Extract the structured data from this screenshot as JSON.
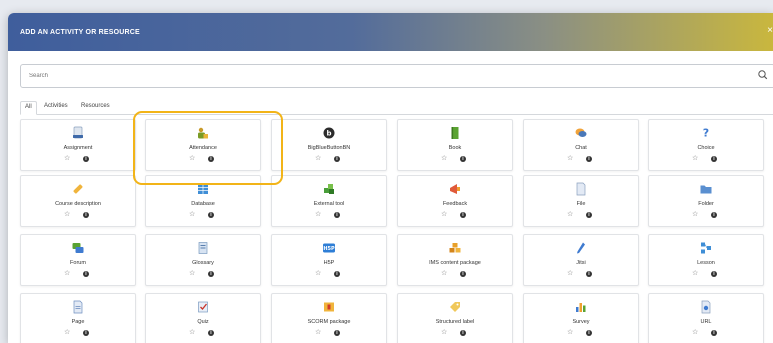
{
  "dialog": {
    "title": "ADD AN ACTIVITY OR RESOURCE",
    "close_label": "×"
  },
  "search": {
    "placeholder": "Search",
    "value": ""
  },
  "tabs": [
    {
      "label": "All"
    },
    {
      "label": "Activities"
    },
    {
      "label": "Resources"
    }
  ],
  "tile_controls": {
    "star": "☆",
    "info": "i"
  },
  "tiles": [
    {
      "label": "Assignment",
      "icon": "assignment-icon"
    },
    {
      "label": "Attendance",
      "icon": "attendance-icon"
    },
    {
      "label": "BigBlueButtonBN",
      "icon": "bigbluebutton-icon"
    },
    {
      "label": "Book",
      "icon": "book-icon"
    },
    {
      "label": "Chat",
      "icon": "chat-icon"
    },
    {
      "label": "Choice",
      "icon": "choice-icon"
    },
    {
      "label": "Course description",
      "icon": "course-description-icon"
    },
    {
      "label": "Database",
      "icon": "database-icon"
    },
    {
      "label": "External tool",
      "icon": "external-tool-icon"
    },
    {
      "label": "Feedback",
      "icon": "feedback-icon"
    },
    {
      "label": "File",
      "icon": "file-icon"
    },
    {
      "label": "Folder",
      "icon": "folder-icon"
    },
    {
      "label": "Forum",
      "icon": "forum-icon"
    },
    {
      "label": "Glossary",
      "icon": "glossary-icon"
    },
    {
      "label": "H5P",
      "icon": "h5p-icon"
    },
    {
      "label": "IMS content package",
      "icon": "ims-package-icon"
    },
    {
      "label": "Jitsi",
      "icon": "jitsi-icon"
    },
    {
      "label": "Lesson",
      "icon": "lesson-icon"
    },
    {
      "label": "Page",
      "icon": "page-icon"
    },
    {
      "label": "Quiz",
      "icon": "quiz-icon"
    },
    {
      "label": "SCORM package",
      "icon": "scorm-icon"
    },
    {
      "label": "Structured label",
      "icon": "structured-label-icon"
    },
    {
      "label": "Survey",
      "icon": "survey-icon"
    },
    {
      "label": "URL",
      "icon": "url-icon"
    }
  ],
  "highlighted_tile": "Attendance",
  "colors": {
    "highlight": "#f2b418",
    "header_start": "#3f5e9c",
    "header_end": "#c9b73e"
  }
}
